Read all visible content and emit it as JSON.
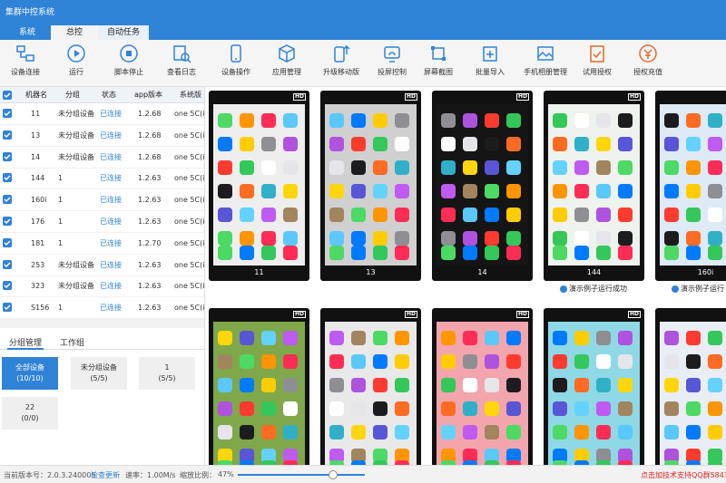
{
  "window": {
    "title": "集群中控系统"
  },
  "tabs": [
    {
      "label": "系统"
    },
    {
      "label": "总控"
    },
    {
      "label": "自动任务"
    }
  ],
  "toolbar": [
    {
      "label": "设备连接",
      "icon": "device-connect-icon"
    },
    {
      "label": "运行",
      "icon": "play-icon"
    },
    {
      "label": "脚本停止",
      "icon": "stop-icon"
    },
    {
      "label": "查看日志",
      "icon": "log-icon"
    },
    {
      "label": "设备操作",
      "icon": "phone-icon"
    },
    {
      "label": "应用管理",
      "icon": "cube-icon"
    },
    {
      "label": "升级移动版",
      "icon": "upgrade-icon"
    },
    {
      "label": "投屏控制",
      "icon": "cast-icon"
    },
    {
      "label": "屏幕截图",
      "icon": "crop-icon"
    },
    {
      "label": "批量导入",
      "icon": "import-icon"
    },
    {
      "label": "手机相册管理",
      "icon": "image-icon"
    },
    {
      "label": "试用授权",
      "icon": "license-icon"
    },
    {
      "label": "授权充值",
      "icon": "recharge-icon"
    }
  ],
  "table": {
    "headers": [
      "机器名",
      "分组",
      "状态",
      "app版本",
      "系统版"
    ],
    "rows": [
      {
        "name": "11",
        "group": "未分组设备",
        "status": "已连接",
        "app": "1.2.68",
        "os": "one 5C(i"
      },
      {
        "name": "13",
        "group": "未分组设备",
        "status": "已连接",
        "app": "1.2.68",
        "os": "one 5C(i"
      },
      {
        "name": "14",
        "group": "未分组设备",
        "status": "已连接",
        "app": "1.2.68",
        "os": "one 5C(i"
      },
      {
        "name": "144",
        "group": "1",
        "status": "已连接",
        "app": "1.2.63",
        "os": "one 5C(i"
      },
      {
        "name": "160i",
        "group": "1",
        "status": "已连接",
        "app": "1.2.63",
        "os": "one 5C(i"
      },
      {
        "name": "176",
        "group": "1",
        "status": "已连接",
        "app": "1.2.63",
        "os": "one 5C(i"
      },
      {
        "name": "181",
        "group": "1",
        "status": "已连接",
        "app": "1.2.70",
        "os": "one 5C(i"
      },
      {
        "name": "253",
        "group": "未分组设备",
        "status": "已连接",
        "app": "1.2.63",
        "os": "one 5C(i"
      },
      {
        "name": "323",
        "group": "未分组设备",
        "status": "已连接",
        "app": "1.2.63",
        "os": "one 5C(i"
      },
      {
        "name": "S156",
        "group": "1",
        "status": "已连接",
        "app": "1.2.63",
        "os": "one 5C(i"
      }
    ]
  },
  "group_tabs": [
    {
      "label": "分组管理"
    },
    {
      "label": "工作组"
    }
  ],
  "groups": [
    {
      "name": "全部设备",
      "count": "(10/10)",
      "active": true
    },
    {
      "name": "未分组设备",
      "count": "(5/5)",
      "active": false
    },
    {
      "name": "1",
      "count": "(5/5)",
      "active": false
    },
    {
      "name": "22",
      "count": "(0/0)",
      "active": false
    }
  ],
  "phones": [
    {
      "name": "11",
      "wallpaper": "#eeeeee",
      "status": ""
    },
    {
      "name": "13",
      "wallpaper": "#d0d0d0",
      "status": ""
    },
    {
      "name": "14",
      "wallpaper": "#151515",
      "status": ""
    },
    {
      "name": "144",
      "wallpaper": "#eef3ee",
      "status": "演示例子运行成功"
    },
    {
      "name": "160i",
      "wallpaper": "#dfeaf7",
      "status": "演示例子运行"
    },
    {
      "name": "",
      "wallpaper": "#7fa84a",
      "status": ""
    },
    {
      "name": "",
      "wallpaper": "#e9e9e9",
      "status": ""
    },
    {
      "name": "",
      "wallpaper": "#f3a5ae",
      "status": ""
    },
    {
      "name": "",
      "wallpaper": "#8fd8e6",
      "status": ""
    },
    {
      "name": "",
      "wallpaper": "#e8eef4",
      "status": ""
    }
  ],
  "hd_label": "HD",
  "statusbar": {
    "version": "当前版本号：2.0.3.240005",
    "update": "检查更新",
    "speed": "速率：1.00M/s",
    "zoom": "缩放比例：",
    "zoom_value": "47%",
    "support": "点击加技术支持QQ群5843"
  },
  "colors": {
    "accent": "#2f83d6",
    "support": "#e02020"
  }
}
